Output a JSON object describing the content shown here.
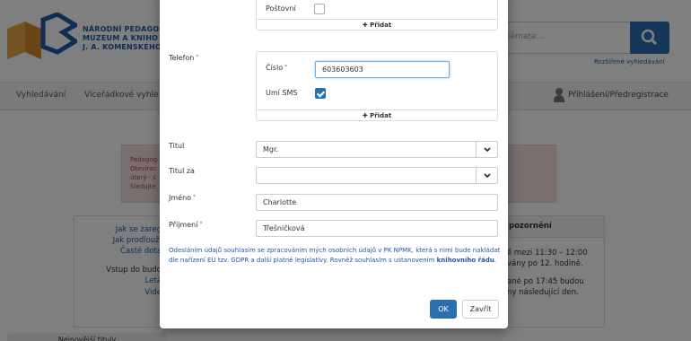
{
  "background": {
    "institution": [
      "NÁRODNÍ PEDAGO",
      "MUZEUM A KNIHO",
      "J. A. KOMENSKÉHO"
    ],
    "search_placeholder": "témata...",
    "advanced_search": "Rozšířené vyhledávání",
    "nav": [
      "Vyhledávání",
      "Víceřádkové vyhle"
    ],
    "login": "Přihlášení/Předregistrace",
    "alert_lines": [
      "Pedagog",
      "Otevírac",
      "úterý - č",
      "Sledujte"
    ],
    "left_links": [
      "Jak se zareg",
      "Jak prodlouži",
      "Časté dota",
      "Vstup do budo",
      "Letá",
      "Vide"
    ],
    "right_header": "pozornění",
    "right_text": [
      "ě mezi 11:30 – 12:00",
      "vány po 12. hodině.",
      "",
      "ané po 17:45 budou",
      "ny následující den."
    ],
    "bottom_tab": "Nejnovější tituly"
  },
  "modal": {
    "postovni_label": "Poštovní",
    "add_label": "Přidat",
    "telefon_label": "Telefon",
    "cislo_label": "Číslo",
    "cislo_value": "603603603",
    "umi_sms_label": "Umí SMS",
    "titul_label": "Titul",
    "titul_value": "Mgr.",
    "titul_za_label": "Titul za",
    "titul_za_value": "",
    "jmeno_label": "Jméno",
    "jmeno_value": "Charlotte",
    "prijmeni_label": "Příjmení",
    "prijmeni_value": "Třešničková",
    "consent_text": "Odesláním údajů souhlasím se zpracováním mých osobních údajů v PK NPMK, která s nimi bude nakládat dle nařízení EU tzv. GDPR a další platné legislativy. Rovněž souhlasím s ustanovením",
    "consent_link": "knihovního řádu",
    "ok_label": "OK",
    "close_label": "Zavřít",
    "required_mark": "*"
  },
  "colors": {
    "primary": "#2b6fb0",
    "link": "#1e5aa8",
    "alert_bg": "#f2dede",
    "required": "#d9534f"
  }
}
